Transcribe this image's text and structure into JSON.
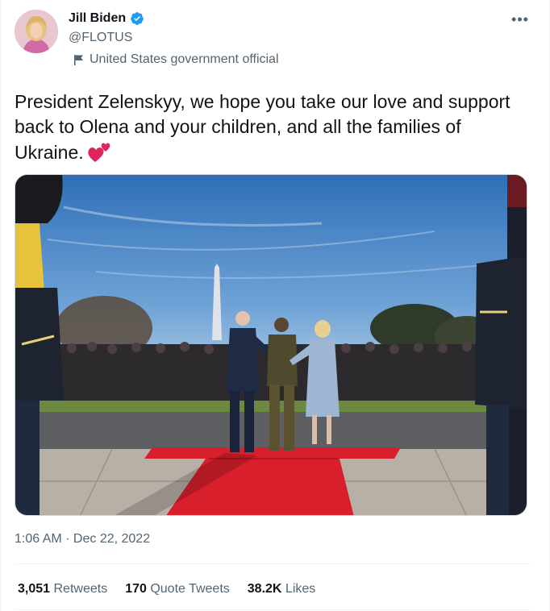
{
  "author": {
    "display_name": "Jill Biden",
    "handle": "@FLOTUS",
    "label": "United States government official",
    "verified_icon": "verified-badge-icon",
    "label_icon": "flag-icon"
  },
  "tweet": {
    "text": "President Zelenskyy, we hope you take our love and support back to Olena and your children, and all the families of Ukraine.",
    "emoji": "two-hearts",
    "timestamp": "1:06 AM · Dec 22, 2022"
  },
  "stats": {
    "retweets_count": "3,051",
    "retweets_label": " Retweets",
    "quote_count": "170",
    "quote_label": " Quote Tweets",
    "likes_count": "38.2K",
    "likes_label": " Likes"
  },
  "menu": {
    "more_label": "•••"
  },
  "colors": {
    "text": "#0f1419",
    "muted": "#536471",
    "verified": "#1d9bf0",
    "heart": "#e0245e",
    "carpet": "#d81f2b"
  }
}
